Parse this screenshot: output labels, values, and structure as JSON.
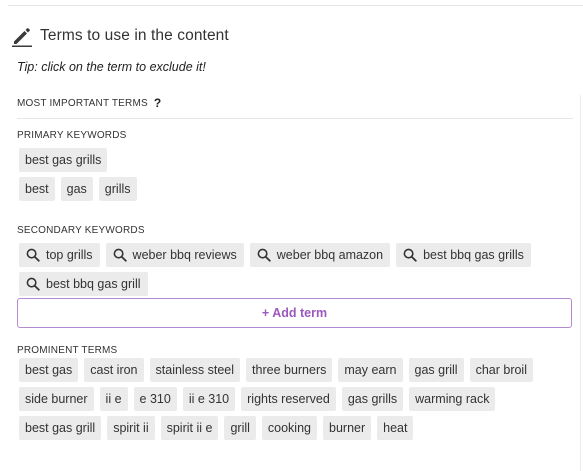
{
  "header": {
    "title": "Terms to use in the content",
    "icon": "pencil-icon"
  },
  "tip": "Tip: click on the term to exclude it!",
  "most_important": {
    "label": "MOST IMPORTANT TERMS",
    "help": "?"
  },
  "primary": {
    "label": "PRIMARY KEYWORDS",
    "row1": [
      "best gas grills"
    ],
    "row2": [
      "best",
      "gas",
      "grills"
    ]
  },
  "secondary": {
    "label": "SECONDARY KEYWORDS",
    "row1": [
      "top grills",
      "weber bbq reviews",
      "weber bbq amazon",
      "best bbq gas grills"
    ],
    "row2": [
      "best bbq gas grill"
    ]
  },
  "add_term": "+ Add term",
  "prominent": {
    "label": "PROMINENT TERMS",
    "row1": [
      "best gas",
      "cast iron",
      "stainless steel",
      "three burners",
      "may earn",
      "gas grill",
      "char broil"
    ],
    "row2": [
      "side burner",
      "ii e",
      "e 310",
      "ii e 310",
      "rights reserved",
      "gas grills",
      "warming rack"
    ],
    "row3": [
      "best gas grill",
      "spirit ii",
      "spirit ii e",
      "grill",
      "cooking",
      "burner",
      "heat"
    ]
  },
  "colors": {
    "accent": "#9b59c0",
    "chip_bg": "#ebebeb"
  }
}
